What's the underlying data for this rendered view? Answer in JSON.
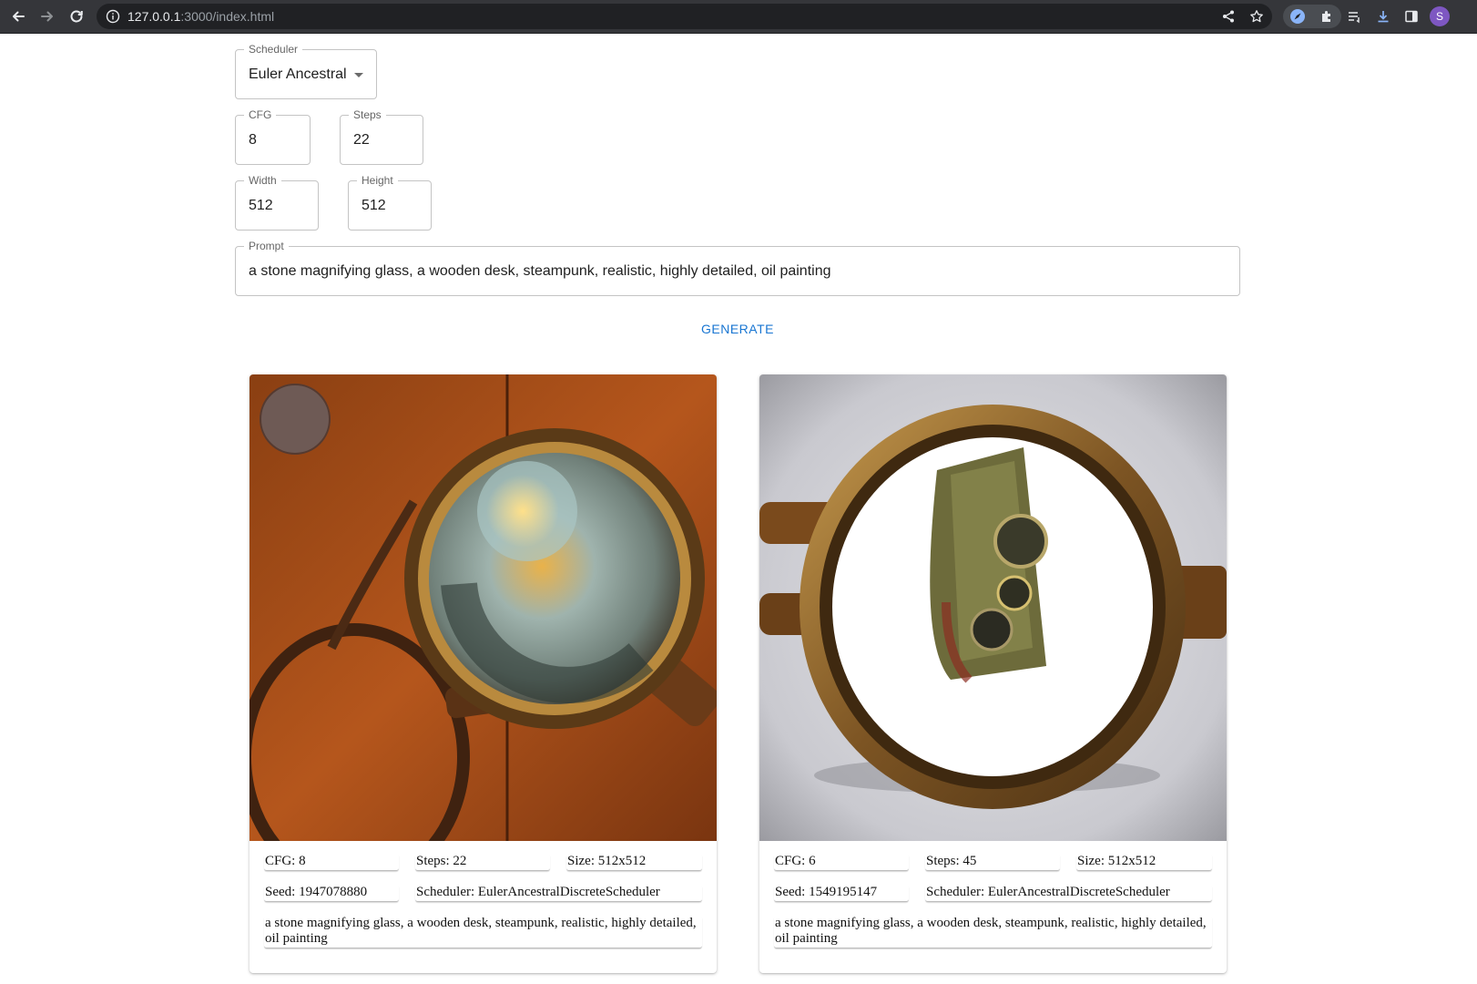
{
  "browser": {
    "url_host": "127.0.0.1",
    "url_path": ":3000/index.html",
    "avatar_letter": "S"
  },
  "form": {
    "scheduler": {
      "label": "Scheduler",
      "value": "Euler Ancestral"
    },
    "cfg": {
      "label": "CFG",
      "value": "8"
    },
    "steps": {
      "label": "Steps",
      "value": "22"
    },
    "width": {
      "label": "Width",
      "value": "512"
    },
    "height": {
      "label": "Height",
      "value": "512"
    },
    "prompt": {
      "label": "Prompt",
      "value": "a stone magnifying glass, a wooden desk, steampunk, realistic, highly detailed, oil painting"
    },
    "generate_label": "GENERATE"
  },
  "results": [
    {
      "cfg": "CFG: 8",
      "steps": "Steps: 22",
      "size": "Size: 512x512",
      "seed": "Seed: 1947078880",
      "scheduler": "Scheduler: EulerAncestralDiscreteScheduler",
      "prompt": "a stone magnifying glass, a wooden desk, steampunk, realistic, highly detailed, oil painting"
    },
    {
      "cfg": "CFG: 6",
      "steps": "Steps: 45",
      "size": "Size: 512x512",
      "seed": "Seed: 1549195147",
      "scheduler": "Scheduler: EulerAncestralDiscreteScheduler",
      "prompt": "a stone magnifying glass, a wooden desk, steampunk, realistic, highly detailed, oil painting"
    }
  ],
  "colors": {
    "accent": "#1976d2",
    "chrome_bg": "#35363a",
    "omnibox_bg": "#202124"
  }
}
